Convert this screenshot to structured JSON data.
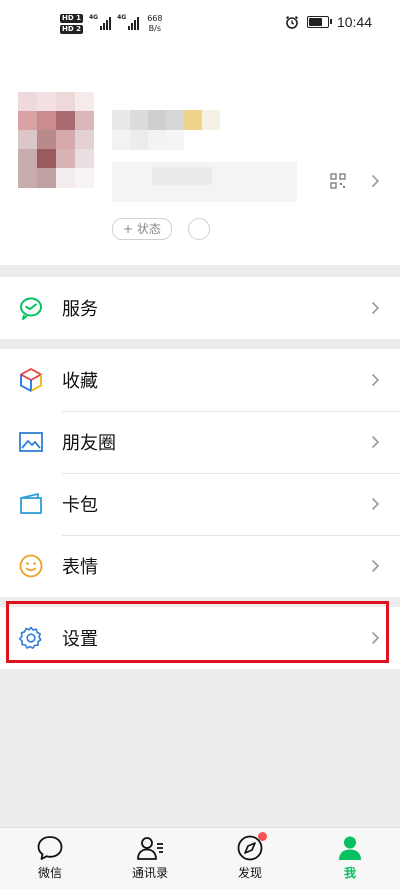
{
  "status_bar": {
    "hd1": "HD 1",
    "hd2": "HD 2",
    "network1": "4G",
    "network2": "4G",
    "speed_value": "668",
    "speed_unit": "B/s",
    "time": "10:44",
    "battery_level": 0.8
  },
  "profile": {
    "status_button_label": "+ 状态"
  },
  "menu": {
    "service": "服务",
    "favorites": "收藏",
    "moments": "朋友圈",
    "cards": "卡包",
    "stickers": "表情",
    "settings": "设置"
  },
  "tabbar": {
    "chats": "微信",
    "contacts": "通讯录",
    "discover": "发现",
    "me": "我"
  },
  "colors": {
    "accent_green": "#07c160",
    "highlight_red": "#e0101c",
    "badge_red": "#fa5151"
  }
}
